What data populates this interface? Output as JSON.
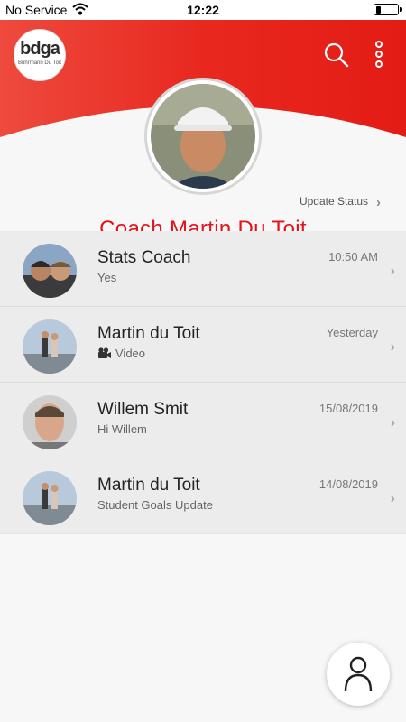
{
  "status_bar": {
    "carrier": "No Service",
    "time": "12:22"
  },
  "header": {
    "logo_mark": "bdga",
    "logo_sub": "Buhrmann Du Toit",
    "icons": [
      "search-icon",
      "more-vert-icon"
    ],
    "accent_color": "#e4121b"
  },
  "profile": {
    "update_status_label": "Update Status",
    "name": "Coach Martin Du Toit"
  },
  "chats": [
    {
      "name": "Stats Coach",
      "subtitle": "Yes",
      "time": "10:50 AM"
    },
    {
      "name": "Martin du Toit",
      "subtitle": "Video",
      "subtitle_icon": "video-camera-icon",
      "time": "Yesterday"
    },
    {
      "name": "Willem Smit",
      "subtitle": "Hi Willem",
      "time": "15/08/2019"
    },
    {
      "name": "Martin du Toit",
      "subtitle": "Student Goals Update",
      "time": "14/08/2019"
    }
  ],
  "fab": {
    "icon": "person-icon"
  }
}
